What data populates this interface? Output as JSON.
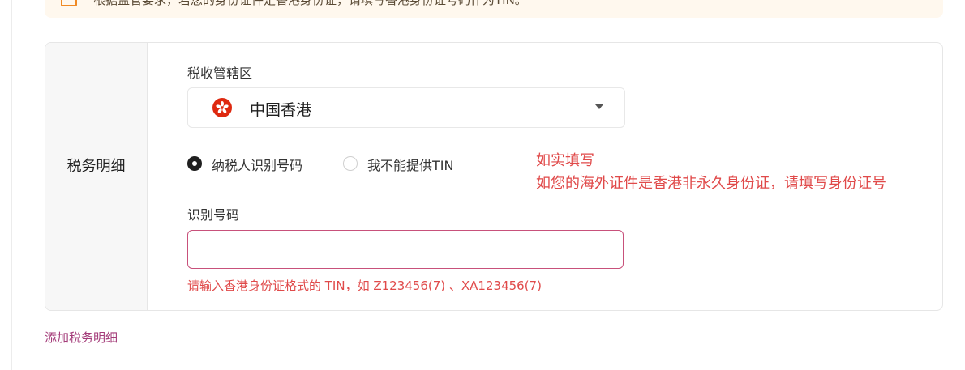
{
  "warning": {
    "text": "根据监管要求，若您的身份证件是香港身份证，请填写香港身份证号码作为TIN。",
    "icon": "warning-icon",
    "accent": "#f08a24"
  },
  "tax_detail": {
    "section_label": "税务明细",
    "jurisdiction_label": "税收管辖区",
    "jurisdiction_value": "中国香港",
    "jurisdiction_flag_icon": "hong-kong-flag-icon",
    "radio_options": [
      {
        "label": "纳税人识别号码",
        "selected": true
      },
      {
        "label": "我不能提供TIN",
        "selected": false
      }
    ],
    "id_label": "识别号码",
    "id_value": "",
    "id_placeholder": "",
    "error_message": "请输入香港身份证格式的 TIN，如 Z123456(7) 、XA123456(7)"
  },
  "annotation": {
    "line1": "如实填写",
    "line2": "如您的海外证件是香港非永久身份证，请填写身份证号",
    "color": "#e04a4a"
  },
  "add_link": {
    "label": "添加税务明细",
    "color": "#a43d7a"
  }
}
